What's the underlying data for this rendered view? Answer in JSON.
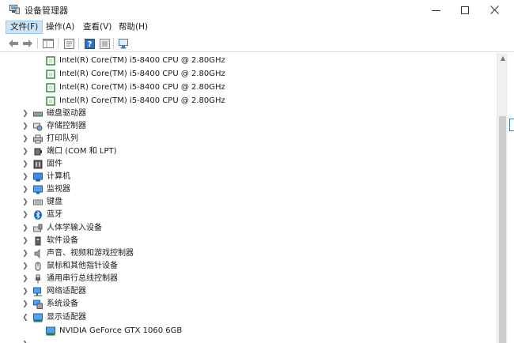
{
  "window": {
    "title": "设备管理器",
    "icon": "device-manager-icon"
  },
  "menu": {
    "items": [
      {
        "label": "文件(F)",
        "active": true
      },
      {
        "label": "操作(A)",
        "active": false
      },
      {
        "label": "查看(V)",
        "active": false
      },
      {
        "label": "帮助(H)",
        "active": false
      }
    ]
  },
  "toolbar": {
    "buttons": [
      "back-icon",
      "forward-icon",
      "show-hide-console-tree-icon",
      "properties-icon",
      "help-icon",
      "scan-hardware-icon"
    ]
  },
  "tree": {
    "processors": [
      "Intel(R) Core(TM) i5-8400 CPU @ 2.80GHz",
      "Intel(R) Core(TM) i5-8400 CPU @ 2.80GHz",
      "Intel(R) Core(TM) i5-8400 CPU @ 2.80GHz",
      "Intel(R) Core(TM) i5-8400 CPU @ 2.80GHz"
    ],
    "categories": [
      {
        "label": "磁盘驱动器",
        "icon": "disk-drive-icon",
        "expanded": false
      },
      {
        "label": "存储控制器",
        "icon": "storage-controller-icon",
        "expanded": false
      },
      {
        "label": "打印队列",
        "icon": "printer-icon",
        "expanded": false
      },
      {
        "label": "端口 (COM 和 LPT)",
        "icon": "port-icon",
        "expanded": false
      },
      {
        "label": "固件",
        "icon": "firmware-icon",
        "expanded": false
      },
      {
        "label": "计算机",
        "icon": "computer-icon",
        "expanded": false
      },
      {
        "label": "监视器",
        "icon": "monitor-icon",
        "expanded": false
      },
      {
        "label": "键盘",
        "icon": "keyboard-icon",
        "expanded": false
      },
      {
        "label": "蓝牙",
        "icon": "bluetooth-icon",
        "expanded": false
      },
      {
        "label": "人体学输入设备",
        "icon": "hid-icon",
        "expanded": false
      },
      {
        "label": "软件设备",
        "icon": "software-device-icon",
        "expanded": false
      },
      {
        "label": "声音、视频和游戏控制器",
        "icon": "sound-icon",
        "expanded": false
      },
      {
        "label": "鼠标和其他指针设备",
        "icon": "mouse-icon",
        "expanded": false
      },
      {
        "label": "通用串行总线控制器",
        "icon": "usb-icon",
        "expanded": false
      },
      {
        "label": "网络适配器",
        "icon": "network-adapter-icon",
        "expanded": false
      },
      {
        "label": "系统设备",
        "icon": "system-device-icon",
        "expanded": false
      },
      {
        "label": "显示适配器",
        "icon": "display-adapter-icon",
        "expanded": true
      }
    ],
    "display_adapters": [
      "NVIDIA GeForce GTX 1060 6GB"
    ]
  },
  "colors": {
    "accent": "#0a64c8",
    "menu_active_bg": "#cce4f7",
    "scrollbar_thumb": "#cdcdcd"
  }
}
